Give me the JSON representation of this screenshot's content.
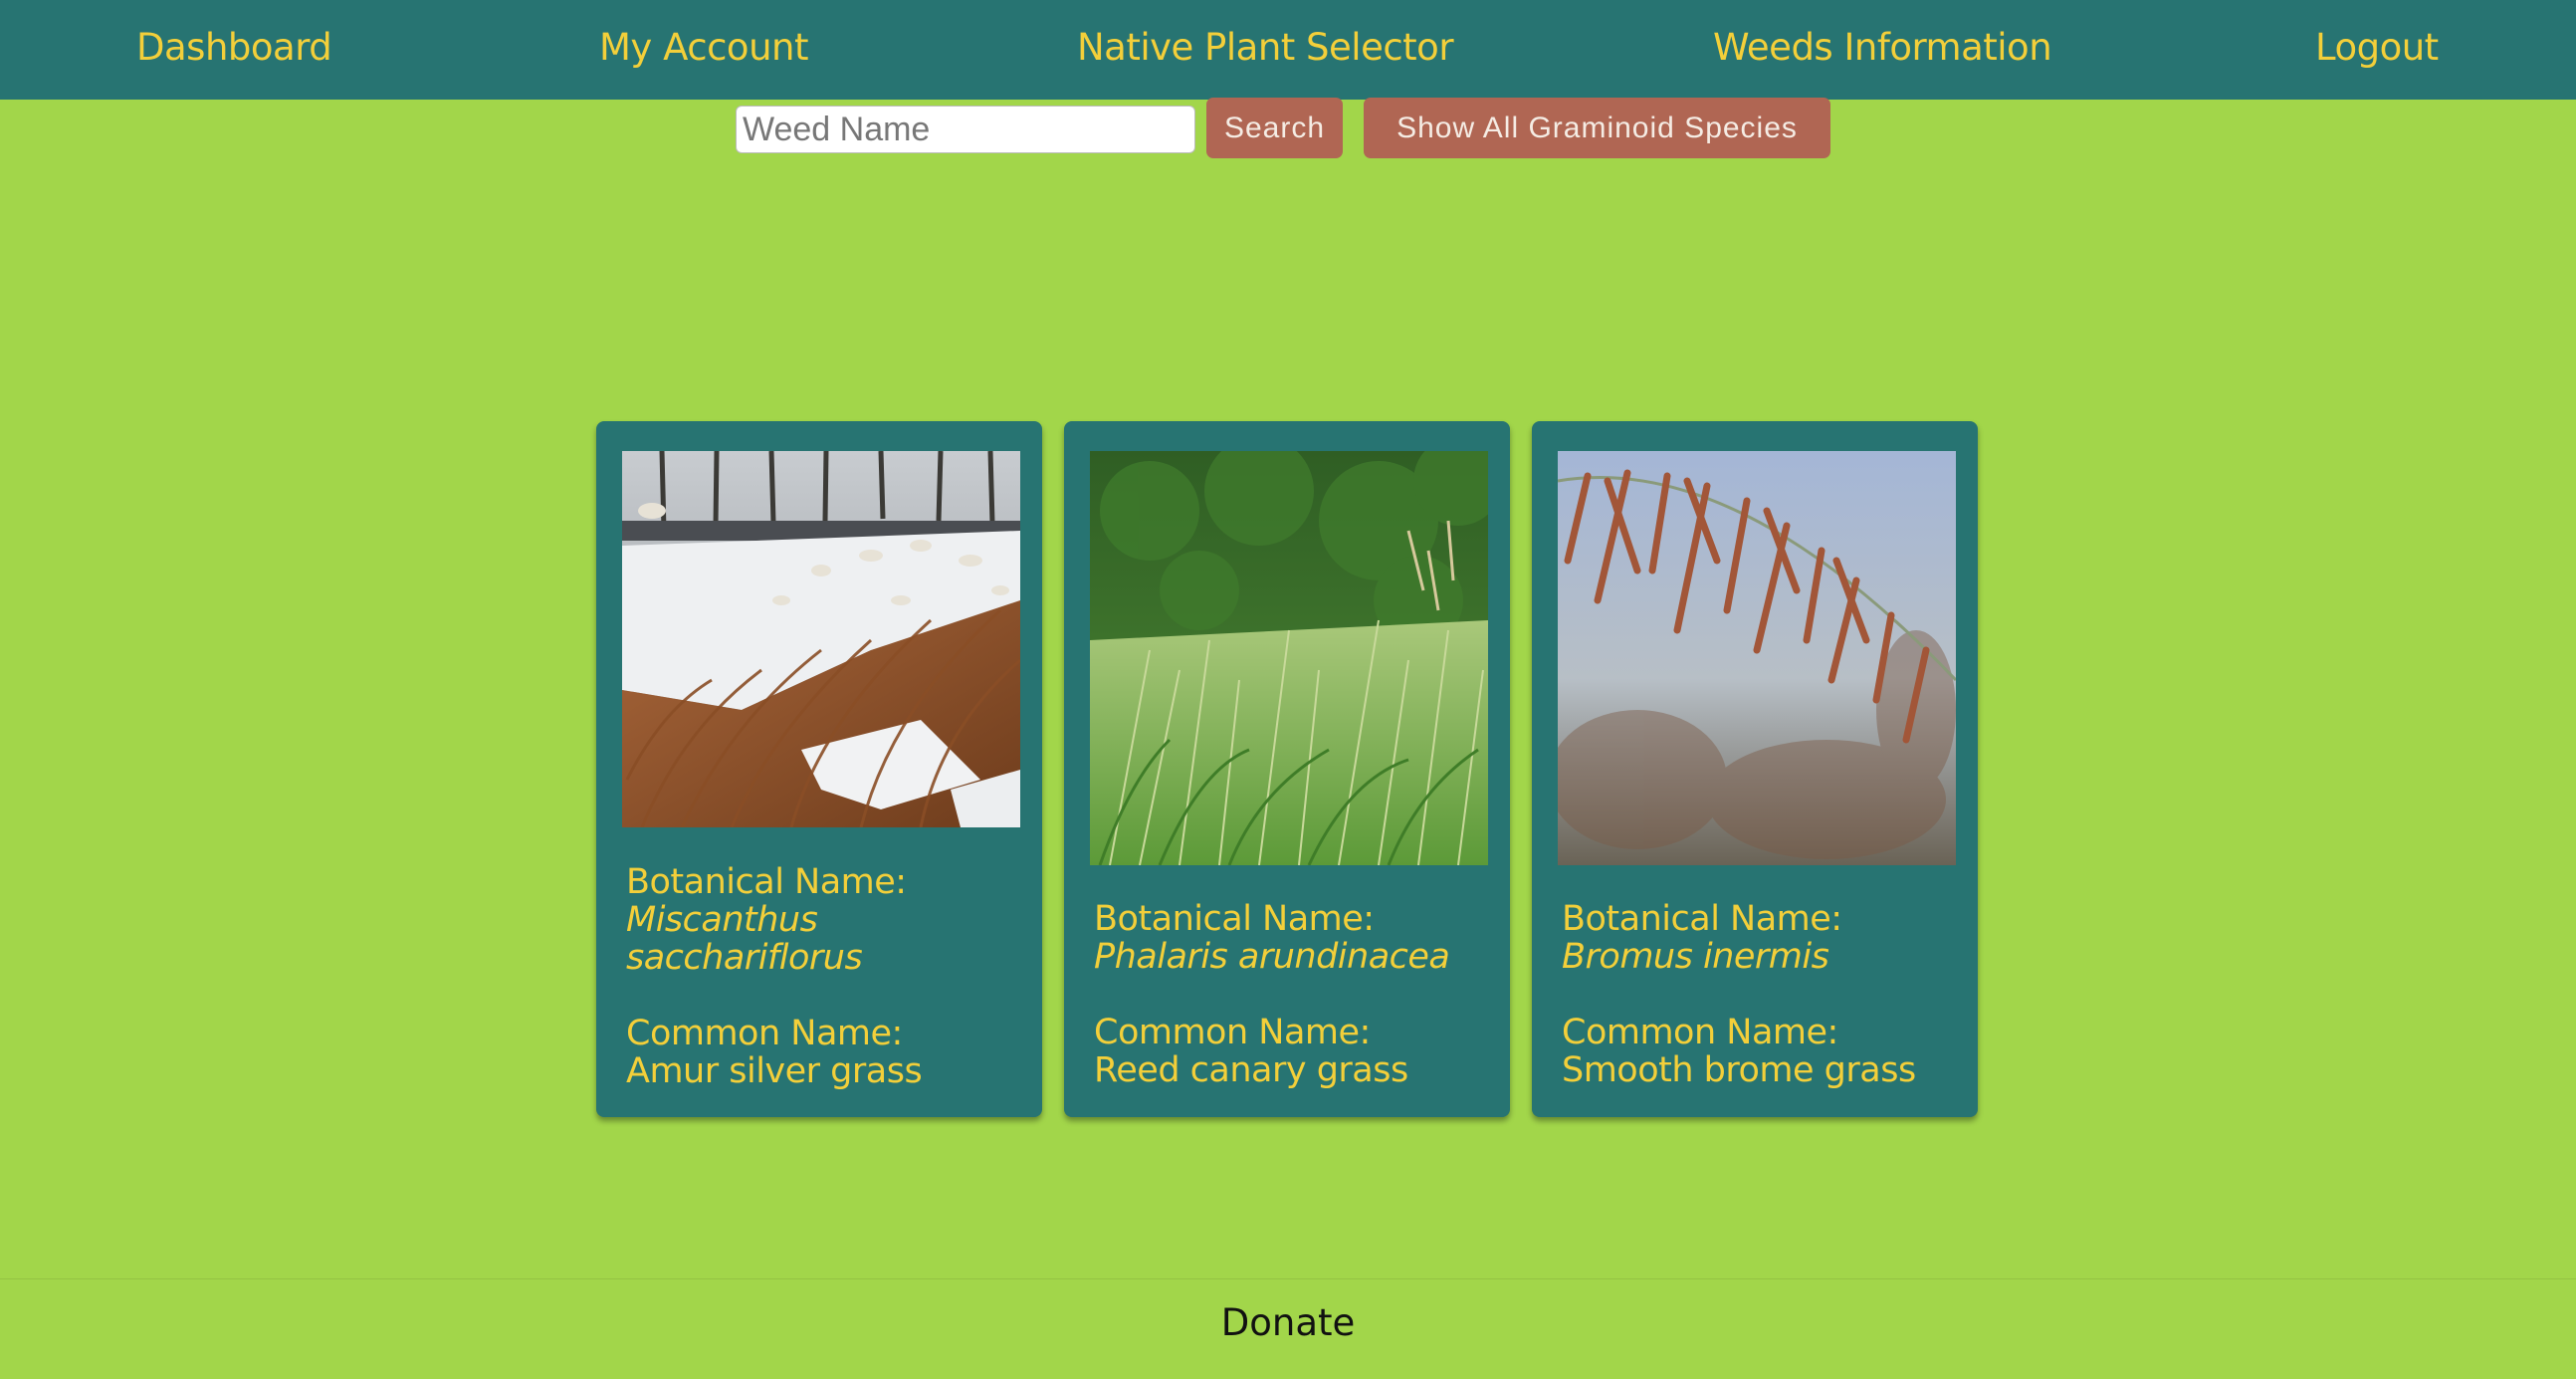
{
  "nav": {
    "dashboard": "Dashboard",
    "account": "My Account",
    "selector": "Native Plant Selector",
    "weeds": "Weeds Information",
    "logout": "Logout"
  },
  "search": {
    "placeholder": "Weed Name",
    "value": "",
    "button": "Search",
    "show_all": "Show All Graminoid Species"
  },
  "cards": [
    {
      "botanical_label": "Botanical Name:",
      "botanical": "Miscanthus sacchariflorus",
      "common_label": "Common Name:",
      "common": "Amur silver grass"
    },
    {
      "botanical_label": "Botanical Name:",
      "botanical": "Phalaris arundinacea",
      "common_label": "Common Name:",
      "common": "Reed canary grass"
    },
    {
      "botanical_label": "Botanical Name:",
      "botanical": "Bromus inermis",
      "common_label": "Common Name:",
      "common": "Smooth brome grass"
    }
  ],
  "footer": {
    "donate": "Donate"
  },
  "colors": {
    "background": "#a2d64a",
    "nav": "#277472",
    "accent_text": "#f3cf3a",
    "button": "#b06653"
  }
}
